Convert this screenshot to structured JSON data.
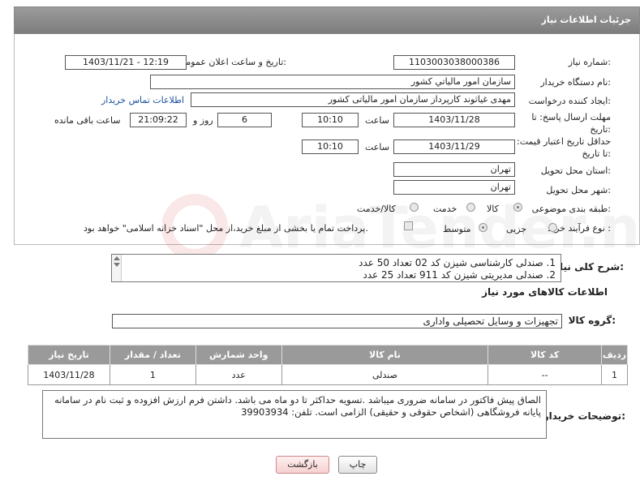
{
  "header": {
    "title": "جزئیات اطلاعات نیاز"
  },
  "fields": {
    "need_number_label": "شماره نیاز:",
    "need_number": "1103003038000386",
    "announce_label": "تاریخ و ساعت اعلان عمومی:",
    "announce_value": "1403/11/21 - 12:19",
    "buyer_org_label": "نام دستگاه خریدار:",
    "buyer_org": "سازمان امور مالياتي كشور",
    "creator_label": "ایجاد کننده درخواست:",
    "creator": "مهدی غیاثوند کارپرداز سازمان امور مالیاتی کشور",
    "contact_link": "اطلاعات تماس خریدار",
    "deadline_label": "مهلت ارسال پاسخ: تا تاریخ:",
    "deadline_date": "1403/11/28",
    "time_word": "ساعت",
    "deadline_time": "10:10",
    "days_value": "6",
    "days_word": "روز و",
    "remaining_time": "21:09:22",
    "remaining_word": "ساعت باقی مانده",
    "min_validity_label": "حداقل تاریخ اعتبار قیمت: تا تاریخ:",
    "validity_date": "1403/11/29",
    "validity_time": "10:10",
    "province_label": "استان محل تحویل:",
    "province": "تهران",
    "city_label": "شهر محل تحویل:",
    "city": "تهران",
    "category_label": "طبقه بندی موضوعی:",
    "category_options": [
      "کالا",
      "خدمت",
      "کالا/خدمت"
    ],
    "process_label": "نوع فرآیند خرید :",
    "process_options": [
      "جزیی",
      "متوسط"
    ],
    "payment_note": "پرداخت تمام یا بخشی از مبلغ خرید،از محل \"اسناد خزانه اسلامی\" خواهد بود."
  },
  "description": {
    "label": "شرح کلی نیاز:",
    "lines": [
      "1. صندلی کارشناسی شیزن کد 02 تعداد 50 عدد",
      "2. صندلی مدیریتی شیزن کد 911 تعداد 25 عدد"
    ]
  },
  "goods_info": {
    "title": "اطلاعات کالاهای مورد نیاز",
    "group_label": "گروه کالا:",
    "group_value": "تجهیزات و وسایل تحصیلی واداری"
  },
  "table": {
    "headers": [
      "ردیف",
      "کد کالا",
      "نام کالا",
      "واحد شمارش",
      "تعداد / مقدار",
      "تاریخ نیاز"
    ],
    "rows": [
      [
        "1",
        "--",
        "صندلی",
        "عدد",
        "1",
        "1403/11/28"
      ]
    ]
  },
  "buyer_notes": {
    "label": "توضیحات خریدار:",
    "text": "الصاق پیش فاکتور در سامانه ضروری میباشد .تسویه حداکثر تا دو ماه می باشد.  داشتن فرم ارزش افزوده و ثبت نام در سامانه پایانه فروشگاهی (اشخاص حقوقی و حقیقی) الزامی است. تلفن:  39903934"
  },
  "buttons": {
    "print": "چاپ",
    "back": "بازگشت"
  },
  "watermark": {
    "text": "AriaTender.neT"
  }
}
